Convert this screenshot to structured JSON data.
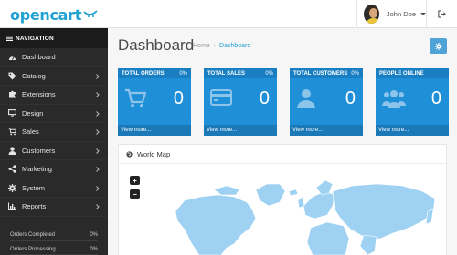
{
  "header": {
    "logo": "opencart",
    "user_name": "John Doe"
  },
  "sidebar": {
    "heading": "NAVIGATION",
    "items": [
      {
        "label": "Dashboard",
        "icon": "dashboard-icon",
        "has_children": false
      },
      {
        "label": "Catalog",
        "icon": "tag-icon",
        "has_children": true
      },
      {
        "label": "Extensions",
        "icon": "puzzle-icon",
        "has_children": true
      },
      {
        "label": "Design",
        "icon": "monitor-icon",
        "has_children": true
      },
      {
        "label": "Sales",
        "icon": "cart-icon",
        "has_children": true
      },
      {
        "label": "Customers",
        "icon": "user-icon",
        "has_children": true
      },
      {
        "label": "Marketing",
        "icon": "share-icon",
        "has_children": true
      },
      {
        "label": "System",
        "icon": "cog-icon",
        "has_children": true
      },
      {
        "label": "Reports",
        "icon": "bar-chart-icon",
        "has_children": true
      }
    ],
    "progress": [
      {
        "label": "Orders Completed",
        "value": "0%",
        "fraction": 0
      },
      {
        "label": "Orders Processing",
        "value": "0%",
        "fraction": 0
      }
    ]
  },
  "main": {
    "title": "Dashboard",
    "breadcrumb": [
      "Home",
      "Dashboard"
    ],
    "tiles": [
      {
        "title": "TOTAL ORDERS",
        "percent": "0%",
        "value": "0",
        "link": "View more...",
        "icon": "cart-icon"
      },
      {
        "title": "TOTAL SALES",
        "percent": "0%",
        "value": "0",
        "link": "View more...",
        "icon": "credit-card-icon"
      },
      {
        "title": "TOTAL CUSTOMERS",
        "percent": "0%",
        "value": "0",
        "link": "View more...",
        "icon": "user-icon"
      },
      {
        "title": "PEOPLE ONLINE",
        "percent": "",
        "value": "0",
        "link": "View more...",
        "icon": "users-icon"
      }
    ],
    "map": {
      "title": "World Map",
      "zoom_in": "+",
      "zoom_out": "−"
    }
  },
  "colors": {
    "accent": "#23a1d1",
    "tile": "#1f8fd8",
    "sidebar": "#2a2a2a",
    "map_land": "#9fd2f2"
  }
}
